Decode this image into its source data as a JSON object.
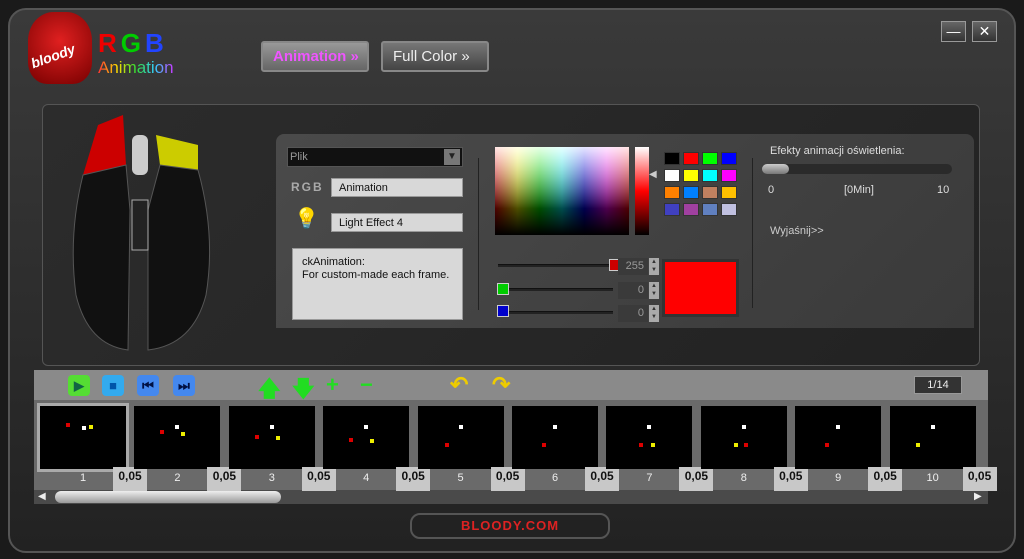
{
  "header": {
    "logo": "bloody",
    "title_r": "R",
    "title_g": "G",
    "title_b": "B",
    "subtitle": "Animation",
    "tabs": [
      {
        "label": "Animation"
      },
      {
        "label": "Full Color"
      }
    ],
    "minimize": "—",
    "close": "✕"
  },
  "editor": {
    "file_select": "Plik",
    "rgb_label": "RGB",
    "name_value": "Animation",
    "effect_value": "Light Effect 4",
    "description_line1": "ckAnimation:",
    "description_line2": "For custom-made each frame."
  },
  "color": {
    "red": "255",
    "green": "0",
    "blue": "0",
    "selected": "#ff0000",
    "swatches": [
      "#000000",
      "#ff0000",
      "#00ff00",
      "#0000ff",
      "#ffffff",
      "#ffff00",
      "#00ffff",
      "#ff00ff",
      "#ff8000",
      "#0080ff",
      "#c08060",
      "#ffc000",
      "#4040c0",
      "#a040a0",
      "#6080c0",
      "#c0c0e0"
    ]
  },
  "effects": {
    "label": "Efekty animacji oświetlenia:",
    "min": "0",
    "current": "[0Min]",
    "max": "10",
    "value": 0,
    "explain": "Wyjaśnij>>"
  },
  "toolbar": {
    "frame_counter": "1/14"
  },
  "frames": [
    {
      "label": "1",
      "delay": "0,05"
    },
    {
      "label": "2",
      "delay": "0,05"
    },
    {
      "label": "3",
      "delay": "0,05"
    },
    {
      "label": "4",
      "delay": "0,05"
    },
    {
      "label": "5",
      "delay": "0,05"
    },
    {
      "label": "6",
      "delay": "0,05"
    },
    {
      "label": "7",
      "delay": "0,05"
    },
    {
      "label": "8",
      "delay": "0,05"
    },
    {
      "label": "9",
      "delay": "0,05"
    },
    {
      "label": "10",
      "delay": "0,05"
    }
  ],
  "footer": {
    "brand": "BLOODY.COM"
  }
}
